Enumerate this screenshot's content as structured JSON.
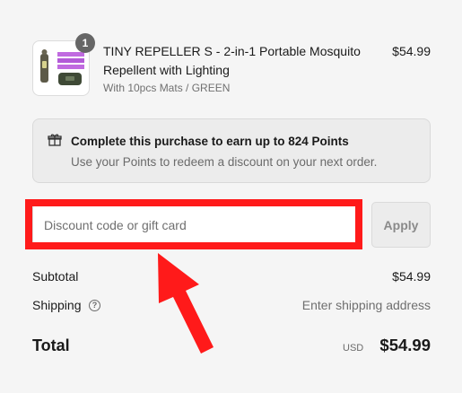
{
  "product": {
    "image_icon": "mosquito-repeller-product-image",
    "quantity_badge": "1",
    "title": "TINY REPELLER S - 2-in-1 Portable Mosquito Repellent with Lighting",
    "variant": "With 10pcs Mats / GREEN",
    "price": "$54.99"
  },
  "points": {
    "icon": "gift-icon",
    "title": "Complete this purchase to earn up to 824 Points",
    "subtitle": "Use your Points to redeem a discount on your next order."
  },
  "discount": {
    "placeholder": "Discount code or gift card",
    "value": "",
    "apply_label": "Apply",
    "highlight_color": "#ff1a1a"
  },
  "summary": {
    "subtotal_label": "Subtotal",
    "subtotal_value": "$54.99",
    "shipping_label": "Shipping",
    "shipping_help_icon": "question-circle-icon",
    "shipping_value": "Enter shipping address",
    "total_label": "Total",
    "currency": "USD",
    "total_value": "$54.99"
  }
}
